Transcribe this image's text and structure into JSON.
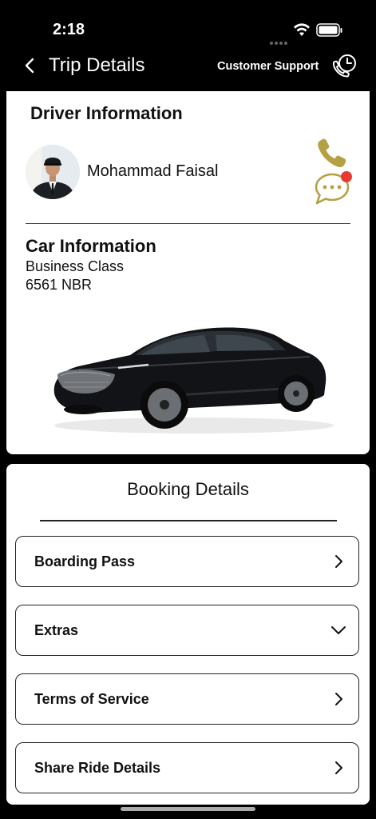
{
  "status_bar": {
    "time": "2:18"
  },
  "nav": {
    "back_icon": "chevron-left-icon",
    "title": "Trip Details",
    "support_label": "Customer Support",
    "support_icon": "phone-clock-icon"
  },
  "driver": {
    "heading": "Driver Information",
    "name": "Mohammad Faisal",
    "call_icon": "phone-icon",
    "chat_icon": "chat-bubble-icon",
    "chat_badge": "red",
    "accent_color": "#b5a044"
  },
  "car": {
    "heading": "Car Information",
    "class": "Business Class",
    "plate": "6561 NBR"
  },
  "booking": {
    "heading": "Booking Details",
    "items": [
      {
        "label": "Boarding Pass",
        "icon": "chevron-right-icon"
      },
      {
        "label": "Extras",
        "icon": "chevron-down-icon"
      },
      {
        "label": "Terms of Service",
        "icon": "chevron-right-icon"
      },
      {
        "label": "Share Ride Details",
        "icon": "chevron-right-icon"
      }
    ]
  }
}
